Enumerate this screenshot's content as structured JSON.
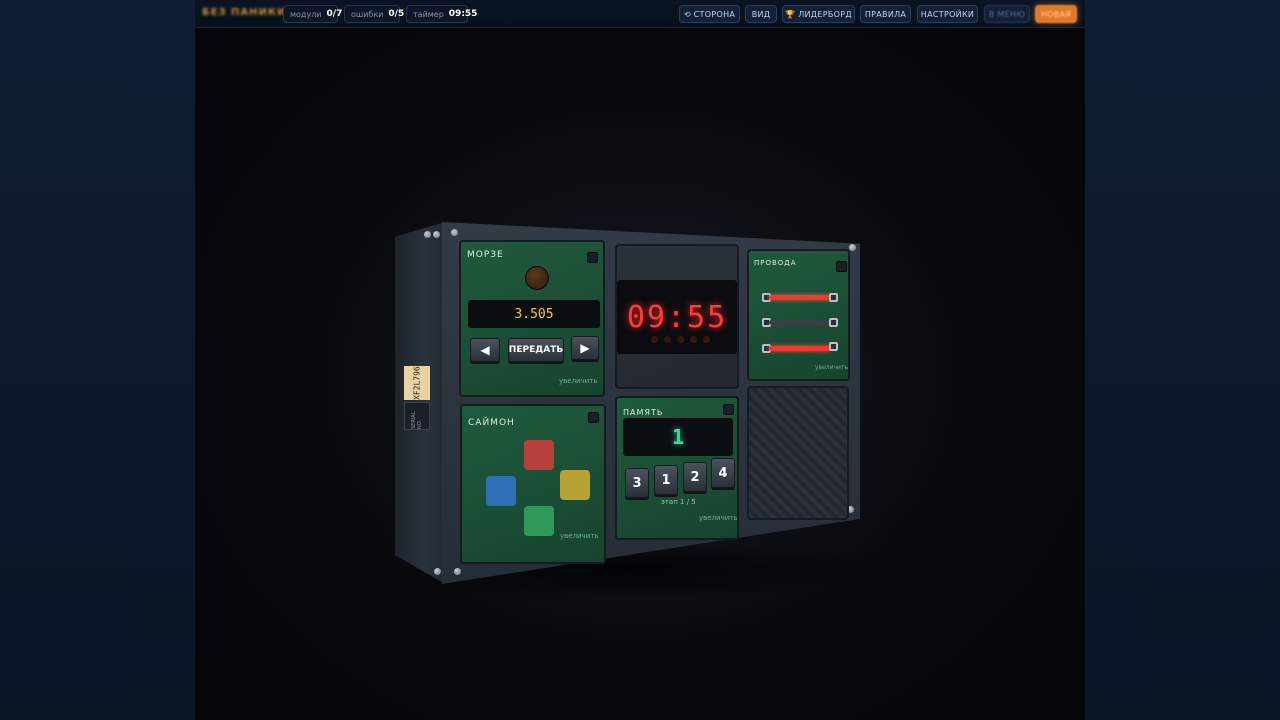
{
  "header": {
    "logo": "БЕЗ ПАНИКИ",
    "stats": [
      {
        "label": "модули",
        "value": "0/7"
      },
      {
        "label": "ошибки",
        "value": "0/5"
      },
      {
        "label": "таймер",
        "value": "09:55"
      }
    ],
    "nav": {
      "side": "⟲ СТОРОНА",
      "view": "ВИД",
      "leaderboard": "🏆 ЛИДЕРБОРД",
      "rules": "ПРАВИЛА",
      "settings": "НАСТРОЙКИ",
      "menu": "В МЕНЮ",
      "extra": "НОВАЯ"
    }
  },
  "bomb": {
    "serial": "XF2L796",
    "side_label": "SERIAL NO.",
    "morse": {
      "title": "МОРЗЕ",
      "frequency": "3.505",
      "transmit": "ПЕРЕДАТЬ",
      "left": "◀",
      "right": "▶",
      "zoom": "увеличить"
    },
    "timer": {
      "display": "09:55"
    },
    "wires": {
      "title": "ПРОВОДА",
      "zoom": "увеличить",
      "colors": [
        "#ee3a32",
        "#3a3f45",
        "#ee3a32"
      ]
    },
    "simon": {
      "title": "САЙМОН",
      "zoom": "увеличить",
      "colors": {
        "red": "#b8403a",
        "blue": "#2f6fb8",
        "yellow": "#b8a234",
        "green": "#2f9a57"
      }
    },
    "memory": {
      "title": "ПАМЯТЬ",
      "display": "1",
      "keys": [
        "3",
        "1",
        "2",
        "4"
      ],
      "stage": "этап 1 / 5",
      "zoom": "увеличить"
    }
  }
}
